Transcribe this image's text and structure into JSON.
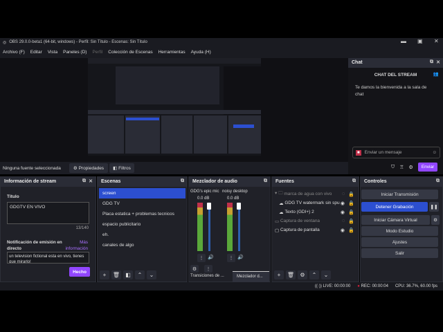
{
  "window": {
    "title": "OBS 29.0.0-beta1 (64-bit, windows) - Perfil: Sin Título - Escenas: Sin Título",
    "controls": [
      "minimize",
      "maximize",
      "close"
    ]
  },
  "menu": [
    "Archivo (F)",
    "Editar",
    "Vista",
    "Paneles (D)",
    "Perfil",
    "Colección de Escenas",
    "Herramientas",
    "Ayuda (H)"
  ],
  "source_bar": {
    "status": "Ninguna fuente seleccionada",
    "properties": "Propiedades",
    "filters": "Filtros"
  },
  "chat": {
    "dock_title": "Chat",
    "header": "CHAT DEL STREAM",
    "welcome": "Te damos la bienvenida a la sala de chat",
    "placeholder": "Enviar un mensaje",
    "send": "Enviar"
  },
  "stream_info": {
    "title": "Información de stream",
    "title_label": "Título",
    "title_value": "GDGTV EN VIVO",
    "counter": "13/140",
    "notif_label": "Notificación de emisión en directo",
    "more_info": "Más información",
    "notif_value": "un television fictional esta en vivo, tienes que mirarlo!",
    "done": "Hecho"
  },
  "scenes": {
    "title": "Escenas",
    "items": [
      "screen",
      "GDG TV",
      "Placa estatica + problemas tecnicos",
      "espacio publicitario",
      "eh.",
      "canales de algo"
    ]
  },
  "mixer": {
    "title": "Mezclador de audio",
    "channels": [
      {
        "name": "GDG's epic mic",
        "level": "0.0 dB"
      },
      {
        "name": "noisy desktop",
        "level": "0.0 dB"
      }
    ],
    "tabs": [
      "Transiciones de ...",
      "Mezclador d..."
    ]
  },
  "sources": {
    "title": "Fuentes",
    "items": [
      "marca de agua con vivo",
      "GDG TV watermark sin spu",
      "Texto (GDI+) 2",
      "Captura de ventana",
      "Captura de pantalla"
    ]
  },
  "controls": {
    "title": "Controles",
    "start_stream": "Iniciar Transmisión",
    "stop_recording": "Detener Grabación",
    "virtual_cam": "Iniciar Cámara Virtual",
    "studio": "Modo Estudio",
    "settings": "Ajustes",
    "exit": "Salir"
  },
  "status": {
    "live": "LIVE: 00:00:00",
    "rec": "REC: 00:00:04",
    "cpu": "CPU: 36.7%, 60.00 fps"
  },
  "colors": {
    "accent": "#2c4fd0",
    "purple": "#9146ff"
  }
}
